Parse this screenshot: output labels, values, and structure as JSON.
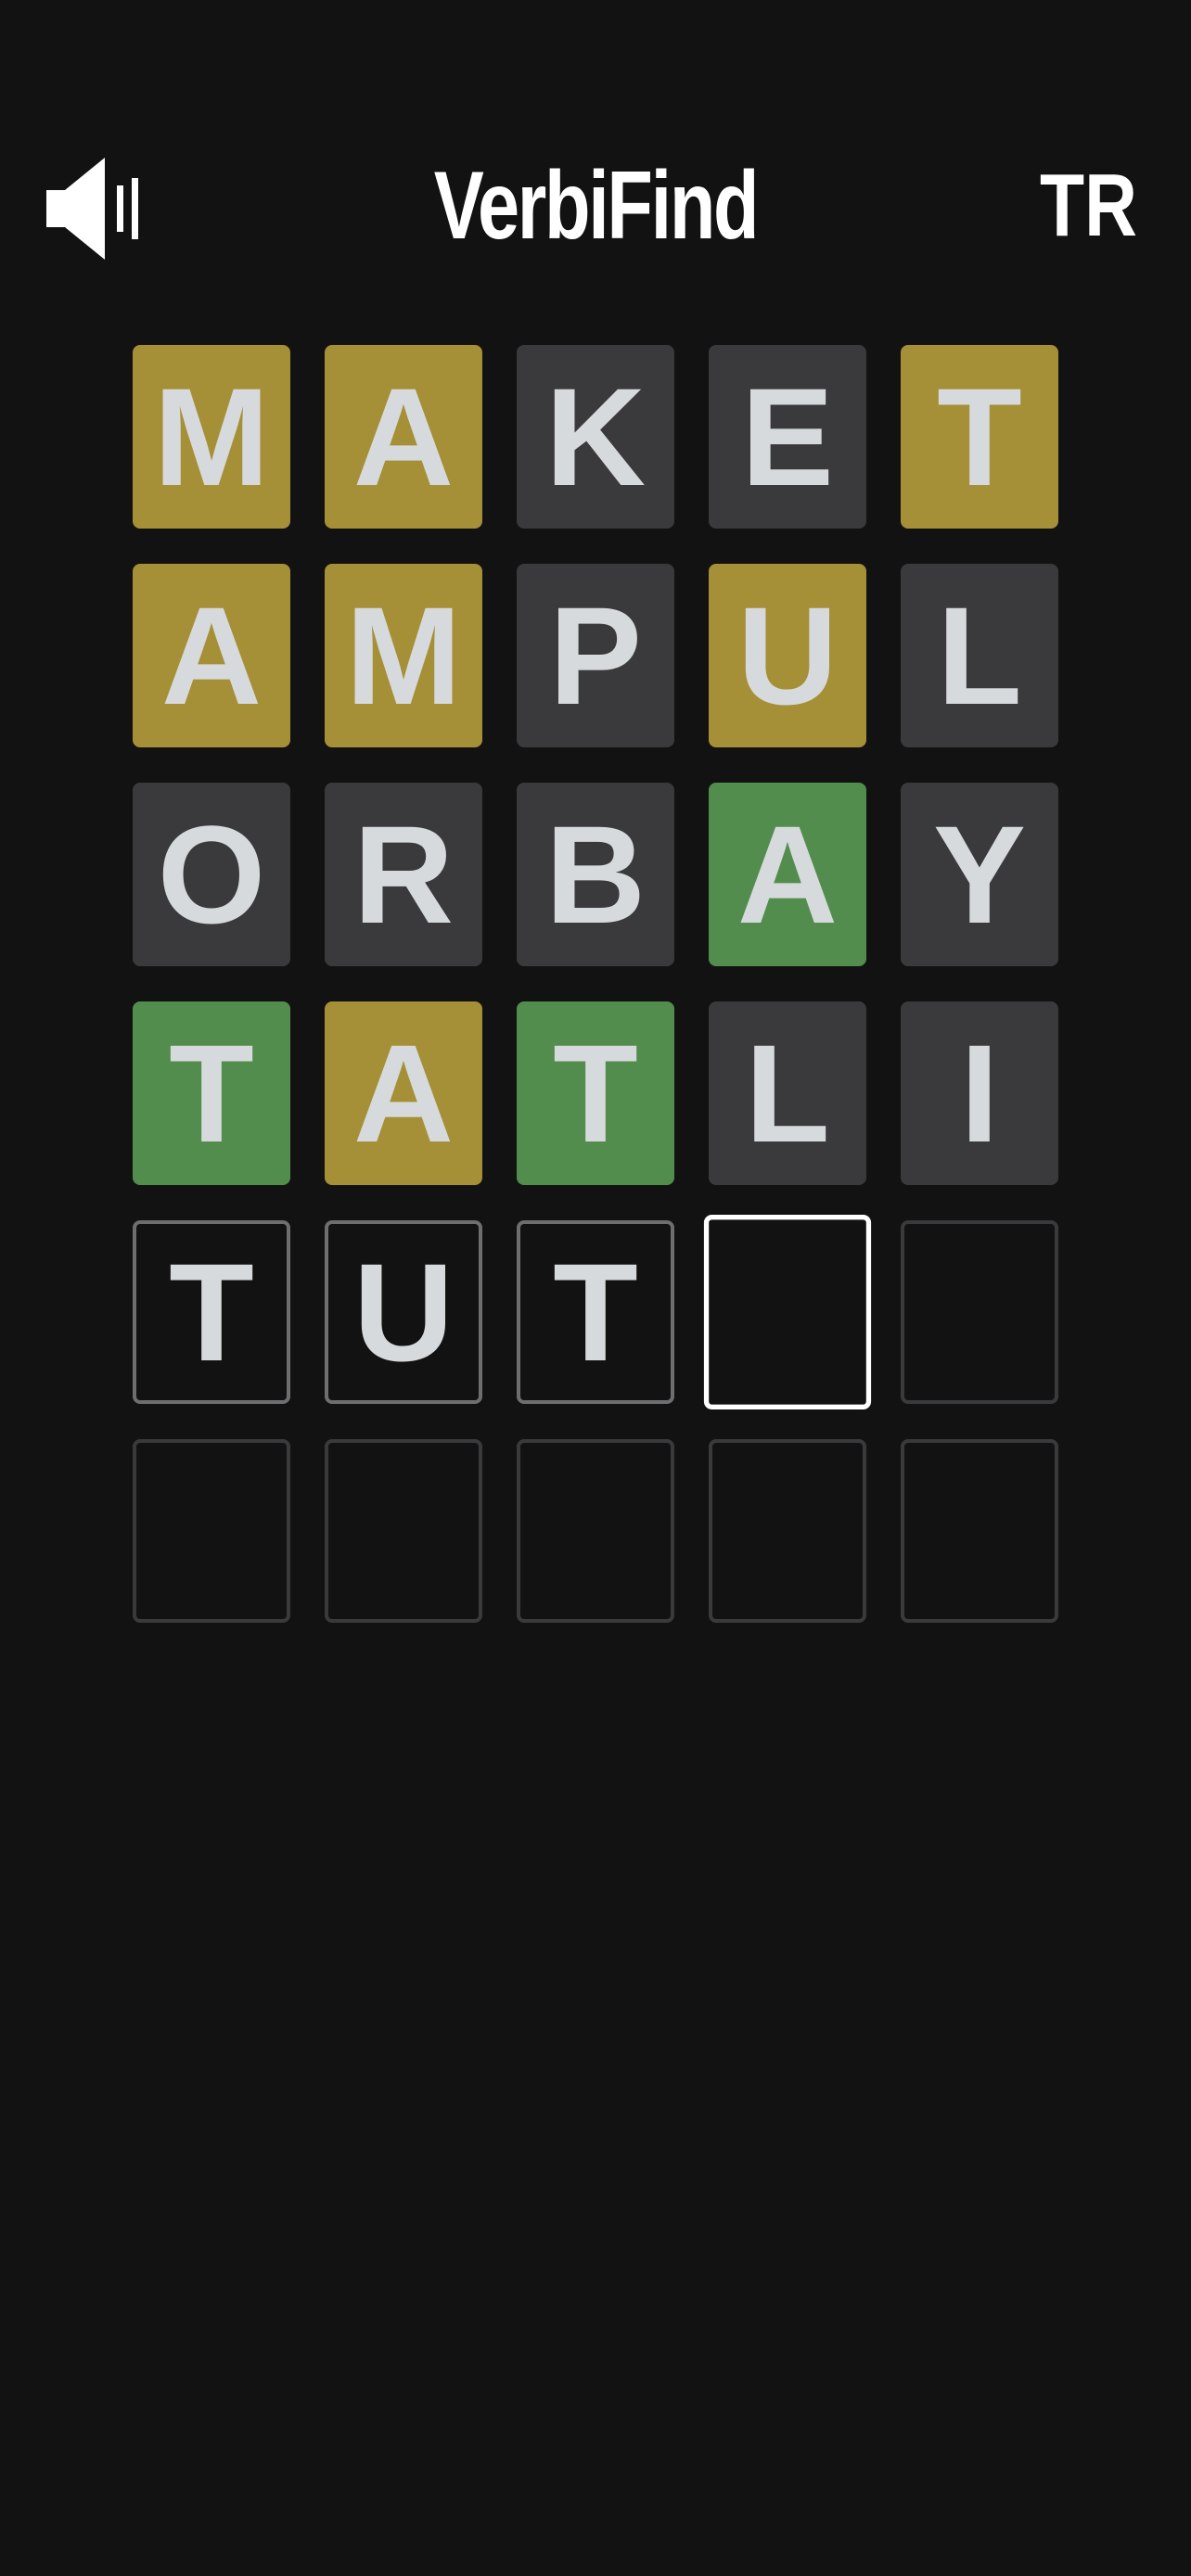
{
  "header": {
    "title": "VerbiFind",
    "language": "TR",
    "sound_icon": "speaker-icon"
  },
  "colors": {
    "background": "#121212",
    "present": "#a58f37",
    "absent": "#3a3a3c",
    "correct": "#538d4e",
    "letter": "#d7dadc"
  },
  "board": {
    "rows": [
      {
        "letters": [
          "M",
          "A",
          "K",
          "E",
          "T"
        ],
        "states": [
          "present",
          "present",
          "absent",
          "absent",
          "present"
        ]
      },
      {
        "letters": [
          "A",
          "M",
          "P",
          "U",
          "L"
        ],
        "states": [
          "present",
          "present",
          "absent",
          "present",
          "absent"
        ]
      },
      {
        "letters": [
          "O",
          "R",
          "B",
          "A",
          "Y"
        ],
        "states": [
          "absent",
          "absent",
          "absent",
          "correct",
          "absent"
        ]
      },
      {
        "letters": [
          "T",
          "A",
          "T",
          "L",
          "I"
        ],
        "states": [
          "correct",
          "present",
          "correct",
          "absent",
          "absent"
        ]
      },
      {
        "letters": [
          "T",
          "U",
          "T",
          "",
          ""
        ],
        "states": [
          "typed",
          "typed",
          "typed",
          "active",
          "empty"
        ]
      },
      {
        "letters": [
          "",
          "",
          "",
          "",
          ""
        ],
        "states": [
          "empty",
          "empty",
          "empty",
          "empty",
          "empty"
        ]
      }
    ]
  }
}
